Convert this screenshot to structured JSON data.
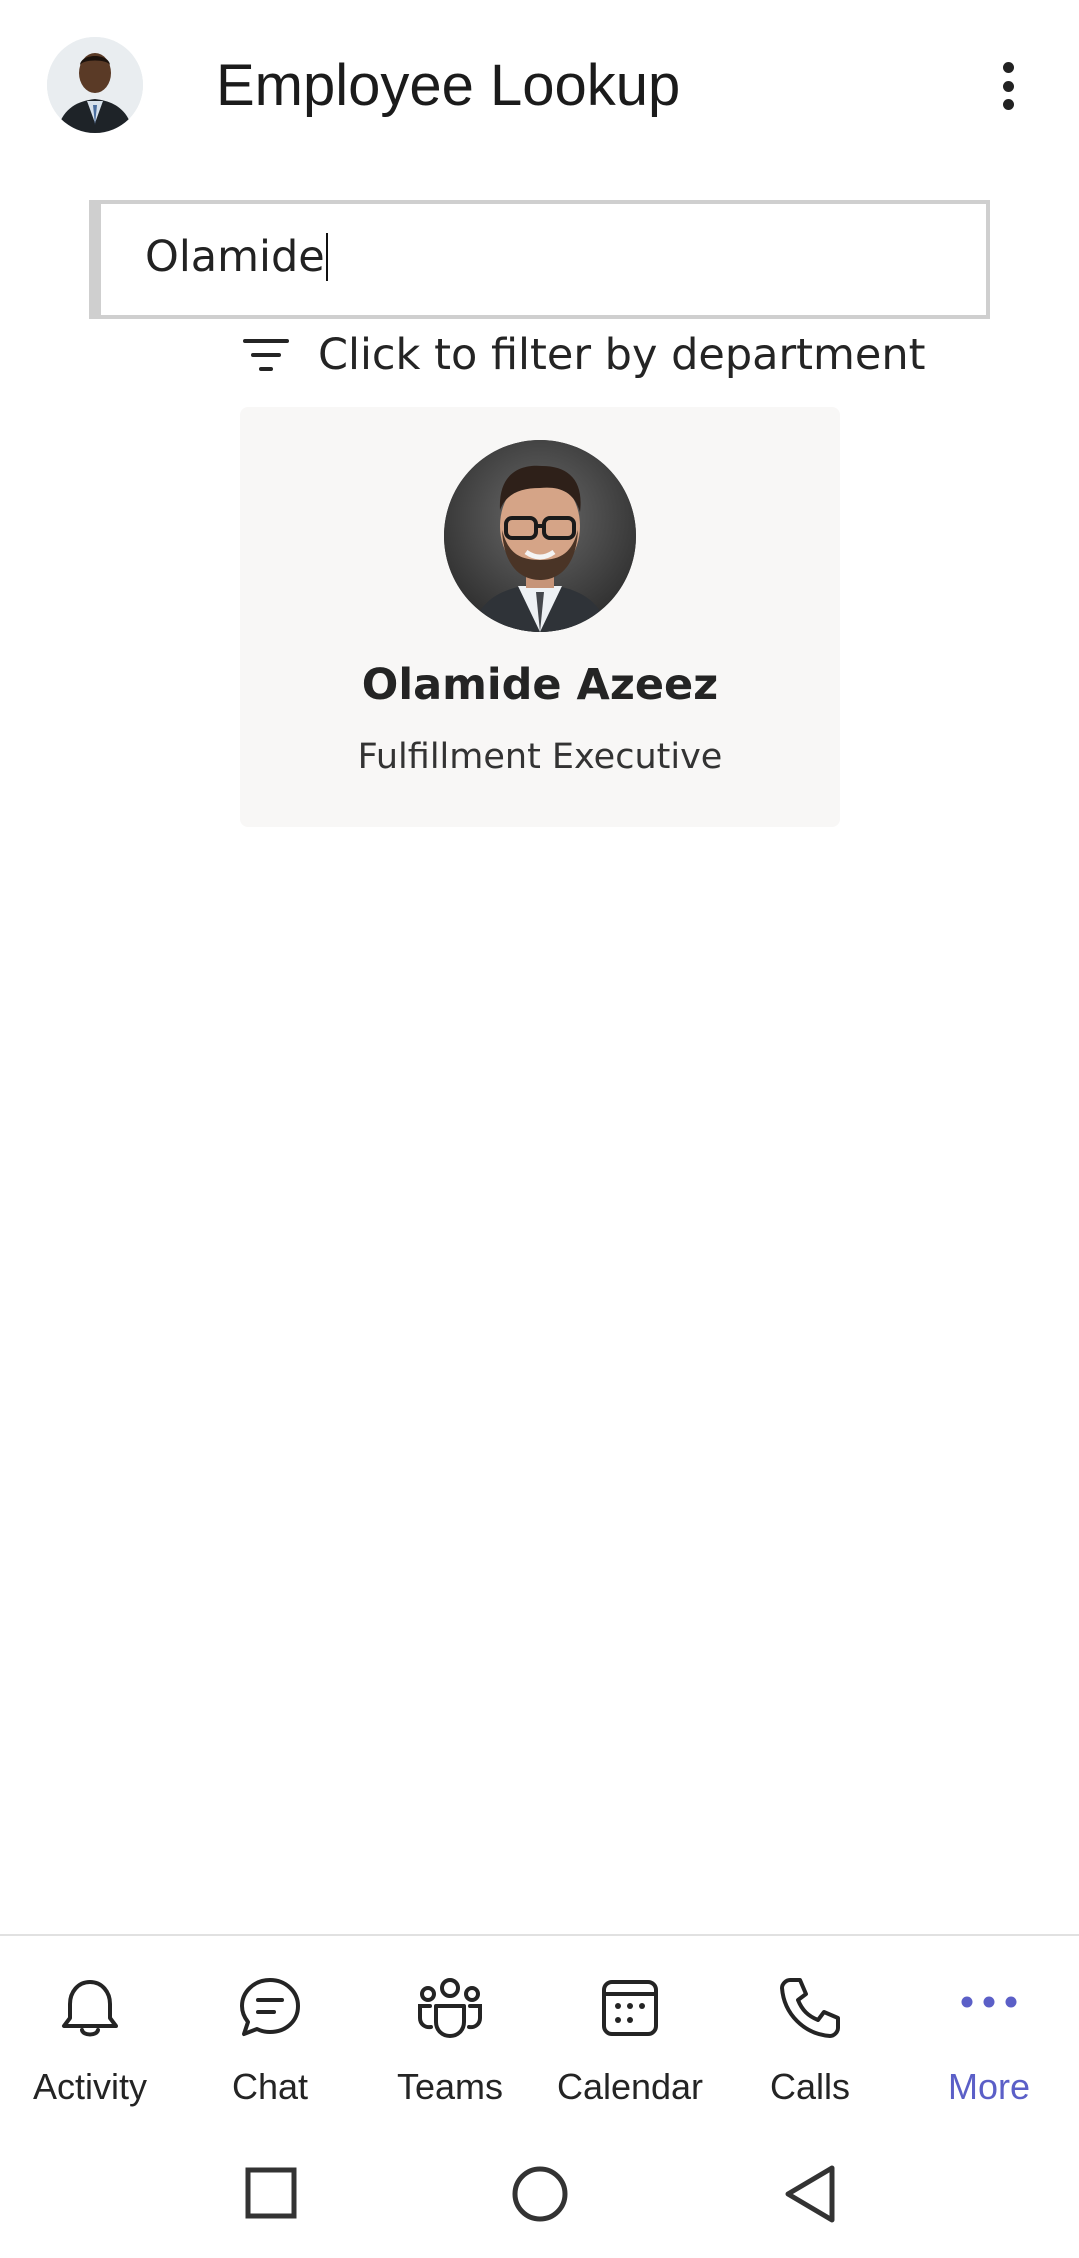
{
  "header": {
    "title": "Employee Lookup",
    "user_avatar_icon": "user-avatar-photo",
    "menu_icon": "more-vertical-icon"
  },
  "search": {
    "value": "Olamide",
    "placeholder": ""
  },
  "filter": {
    "label": "Click to filter by department",
    "icon": "filter-icon"
  },
  "results": [
    {
      "name": "Olamide Azeez",
      "title": "Fulfillment Executive"
    }
  ],
  "bottom_nav": {
    "items": [
      {
        "label": "Activity",
        "icon": "bell-icon"
      },
      {
        "label": "Chat",
        "icon": "chat-icon"
      },
      {
        "label": "Teams",
        "icon": "teams-icon"
      },
      {
        "label": "Calendar",
        "icon": "calendar-icon"
      },
      {
        "label": "Calls",
        "icon": "phone-icon"
      },
      {
        "label": "More",
        "icon": "more-horizontal-icon"
      }
    ],
    "active_color": "#5b5fc7"
  },
  "system_nav": {
    "recents_icon": "square-icon",
    "home_icon": "circle-icon",
    "back_icon": "triangle-back-icon"
  }
}
